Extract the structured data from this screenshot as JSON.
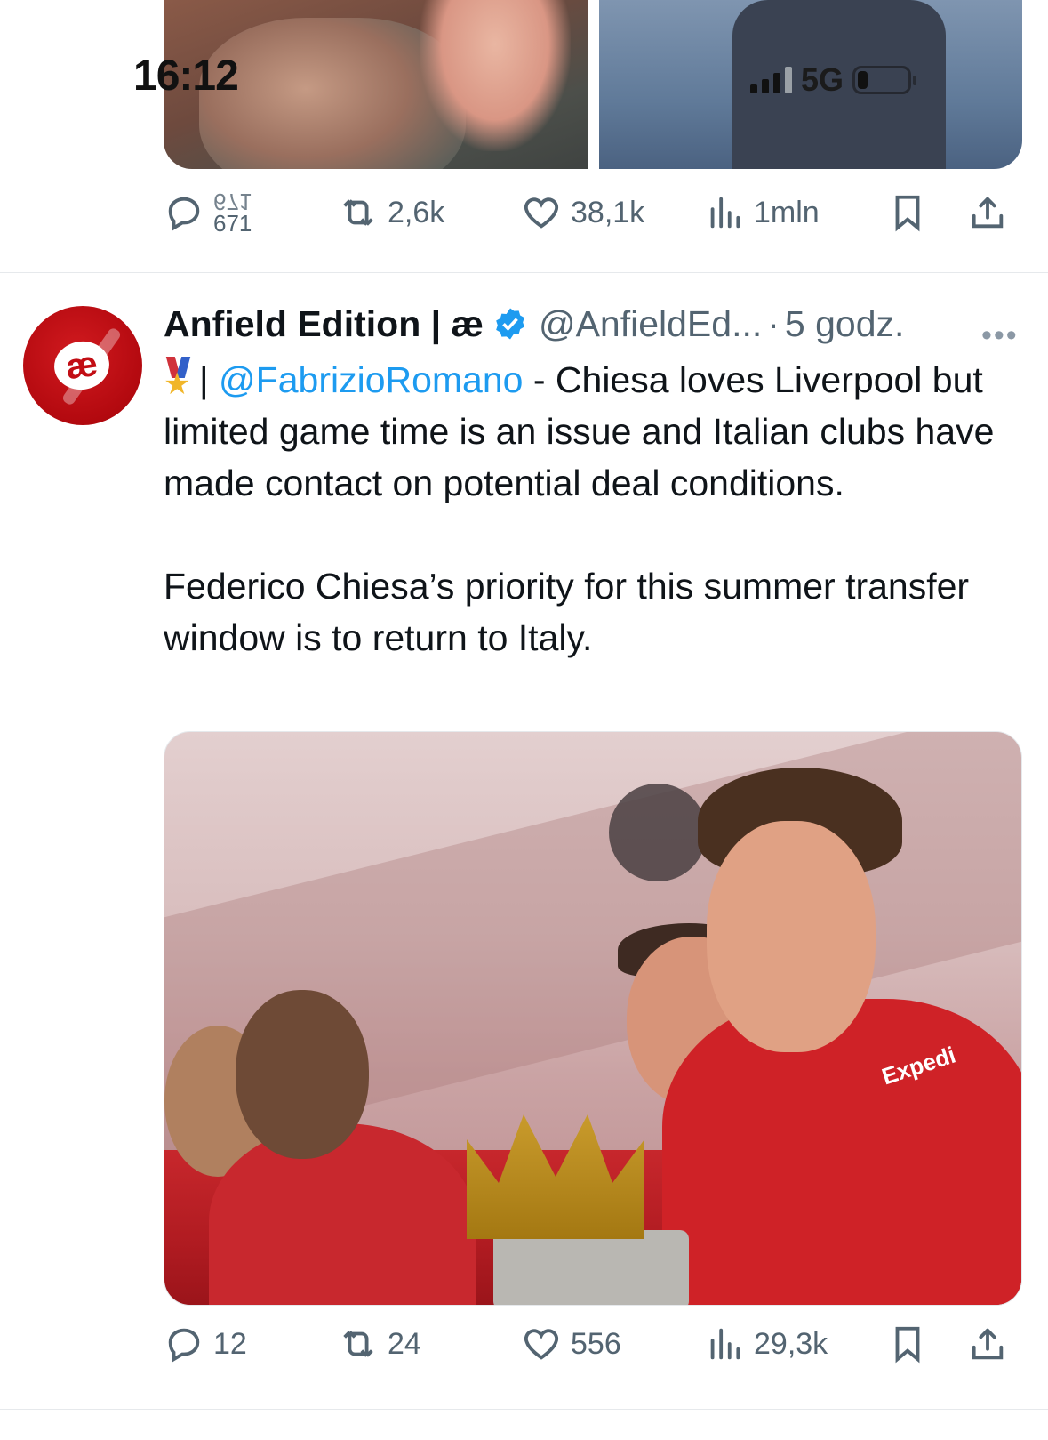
{
  "status_bar": {
    "time": "16:12",
    "network": "5G",
    "battery_level": 0.2
  },
  "previous_tweet": {
    "actions": {
      "replies_line1": "671",
      "replies_line2": "671",
      "retweets": "2,6k",
      "likes": "38,1k",
      "views": "1mln"
    }
  },
  "tweet": {
    "author_name": "Anfield Edition | æ",
    "handle": "@AnfieldEd...",
    "separator": "·",
    "time": "5 godz.",
    "more": "•••",
    "avatar_text": "æ",
    "text": {
      "mention": "@FabrizioRomano",
      "pipe": "| ",
      "line1_rest": " - Chiesa loves Liverpool but limited game time is an issue and Italian clubs have made contact on potential deal conditions.",
      "paragraph2": "Federico Chiesa’s priority for this summer transfer window is to return to Italy."
    },
    "photo": {
      "sponsor_text": "Expedi"
    },
    "actions": {
      "replies": "12",
      "retweets": "24",
      "likes": "556",
      "views": "29,3k"
    }
  },
  "colors": {
    "accent": "#1d9bf0",
    "muted": "#536471",
    "avatar_red": "#c20d14"
  },
  "icons": [
    "reply-icon",
    "retweet-icon",
    "like-icon",
    "views-icon",
    "bookmark-icon",
    "share-icon",
    "verified-icon",
    "medal-icon",
    "more-icon"
  ]
}
